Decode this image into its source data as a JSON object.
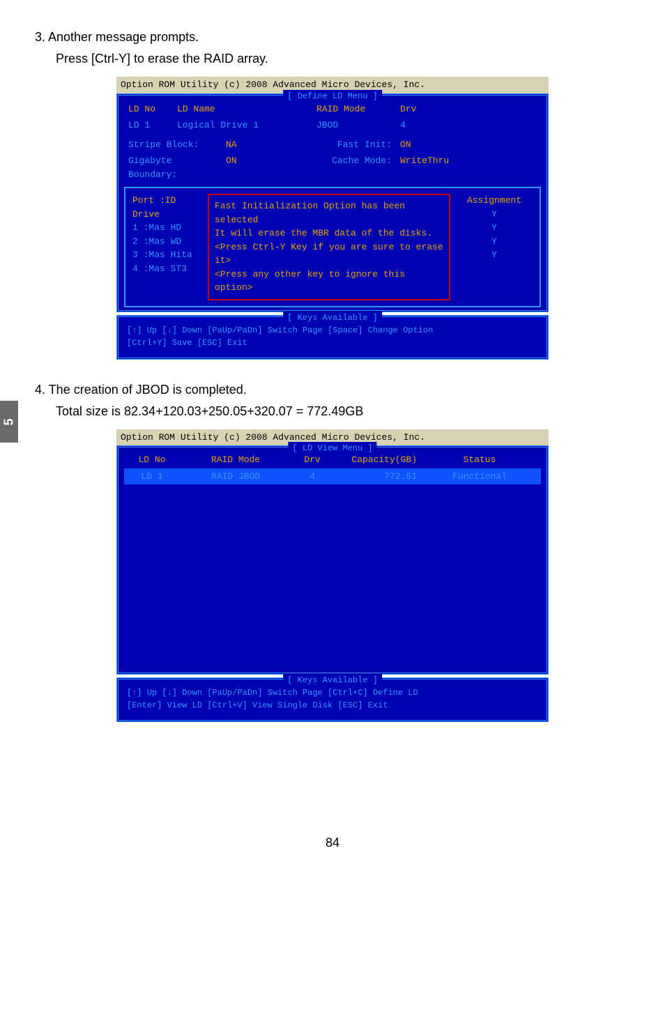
{
  "chapter_tab": "5",
  "step3": {
    "line": "3. Another message prompts.",
    "sub": "Press [Ctrl-Y] to erase the RAID array."
  },
  "rom1": {
    "header": "Option ROM Utility (c) 2008 Advanced Micro Devices, Inc.",
    "define_title": "[ Define LD Menu ]",
    "head": {
      "ldno": "LD No",
      "ldname": "LD Name",
      "raidmode": "RAID Mode",
      "drv": "Drv"
    },
    "data": {
      "ldno": "LD  1",
      "ldname": "Logical Drive 1",
      "raidmode": "JBOD",
      "drv": "4"
    },
    "stripe_label": "Stripe Block:",
    "stripe_val": "NA",
    "fastinit_label": "Fast Init:",
    "fastinit_val": "ON",
    "gb_label": "Gigabyte Boundary:",
    "gb_val": "ON",
    "cache_label": "Cache Mode:",
    "cache_val": "WriteThru",
    "drive_head": {
      "port": "Port :ID  Drive",
      "assign": "Assignment"
    },
    "drives": [
      {
        "left": "1 :Mas  HD",
        "assign": "Y"
      },
      {
        "left": "2 :Mas  WD",
        "assign": "Y"
      },
      {
        "left": "3 :Mas  Hita",
        "assign": "Y"
      },
      {
        "left": "4 :Mas  ST3",
        "assign": "Y"
      }
    ],
    "popup": {
      "l1": "Fast Initialization Option has been selected",
      "l2": "It will erase the MBR data of the disks.",
      "l3": "<Press Ctrl-Y Key if you are sure to erase it>",
      "l4": "<Press any other key to ignore this option>"
    },
    "keys_title": "[ Keys Available ]",
    "keys1": "[↑] Up    [↓] Down    [PaUp/PaDn] Switch Page     [Space] Change Option",
    "keys2": "[Ctrl+Y] Save     [ESC] Exit"
  },
  "step4": {
    "line": "4. The creation of JBOD is completed.",
    "sub": "Total size is 82.34+120.03+250.05+320.07 = 772.49GB"
  },
  "rom2": {
    "header": "Option ROM Utility (c) 2008 Advanced Micro Devices, Inc.",
    "view_title": "[ LD View Menu ]",
    "head": {
      "ldno": "LD No",
      "raidmode": "RAID Mode",
      "drv": "Drv",
      "cap": "Capacity(GB)",
      "status": "Status"
    },
    "row": {
      "ldno": "LD  1",
      "raidmode": "RAID JBOD",
      "drv": "4",
      "cap": "772.51",
      "status": "Functional"
    },
    "keys_title": "[ Keys Available ]",
    "keys1": "[↑] Up    [↓] Down    [PaUp/PaDn] Switch Page     [Ctrl+C] Define LD",
    "keys2": "[Enter] View LD    [Ctrl+V] View Single Disk    [ESC] Exit"
  },
  "pagenum": "84"
}
